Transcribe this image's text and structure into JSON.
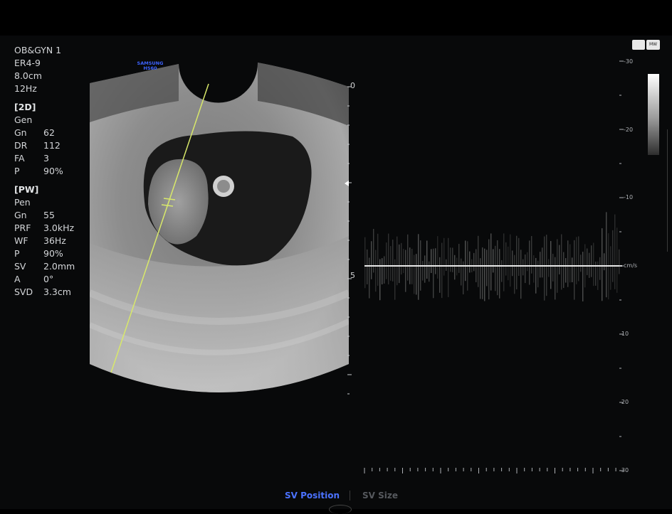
{
  "header": {
    "preset": "OB&GYN 1",
    "probe": "ER4-9",
    "depth": "8.0cm",
    "frame_rate": "12Hz"
  },
  "mode_2d": {
    "title": "[2D]",
    "mode": "Gen",
    "params": [
      {
        "key": "Gn",
        "value": "62"
      },
      {
        "key": "DR",
        "value": "112"
      },
      {
        "key": "FA",
        "value": "3"
      },
      {
        "key": "P",
        "value": "90%"
      }
    ]
  },
  "mode_pw": {
    "title": "[PW]",
    "mode": "Pen",
    "params": [
      {
        "key": "Gn",
        "value": "55"
      },
      {
        "key": "PRF",
        "value": "3.0kHz"
      },
      {
        "key": "WF",
        "value": "36Hz"
      },
      {
        "key": "P",
        "value": "90%"
      },
      {
        "key": "SV",
        "value": "2.0mm"
      },
      {
        "key": "A",
        "value": "0°"
      },
      {
        "key": "SVD",
        "value": "3.3cm"
      }
    ]
  },
  "image": {
    "probe_label_line1": "SAMSUNG",
    "probe_label_line2": "HS60",
    "depth_top": "0",
    "depth_mid": "5"
  },
  "doppler": {
    "unit": "cm/s",
    "velocity_labels": [
      "-30",
      "-20",
      "-10",
      "-10",
      "-20",
      "-30"
    ],
    "icon_label": "MW"
  },
  "menu": {
    "sv_position": "SV Position",
    "sv_size": "SV Size"
  },
  "colors": {
    "accent_active": "#4b72ff",
    "inactive": "#56595e",
    "cursor_line": "#d8e86a"
  }
}
